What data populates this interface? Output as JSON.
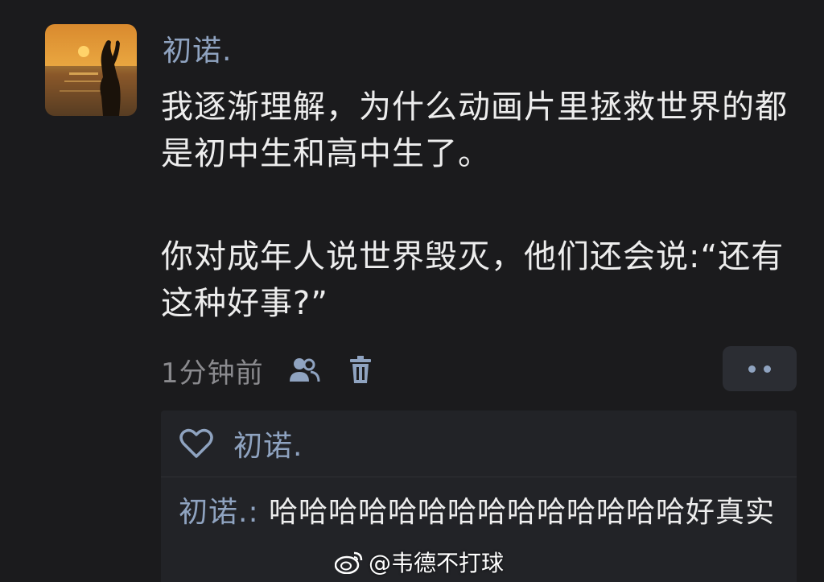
{
  "post": {
    "username": "初诺.",
    "text_line1": "我逐渐理解，为什么动画片里拯救世界的都是初中生和高中生了。",
    "text_line2": "你对成年人说世界毁灭，他们还会说:“还有这种好事?”",
    "timestamp": "1分钟前",
    "icons": [
      "people-icon",
      "trash-icon",
      "more-icon"
    ]
  },
  "reply_box": {
    "liked_by": "初诺.",
    "comment": {
      "author": "初诺.:",
      "text": " 哈哈哈哈哈哈哈哈哈哈哈哈哈哈好真实"
    }
  },
  "watermark": {
    "text": "@韦德不打球",
    "icon": "weibo-logo"
  },
  "colors": {
    "background": "#1b1b1d",
    "accent": "#8fa3c0",
    "text": "#ededed",
    "muted": "#8a8a8e"
  }
}
